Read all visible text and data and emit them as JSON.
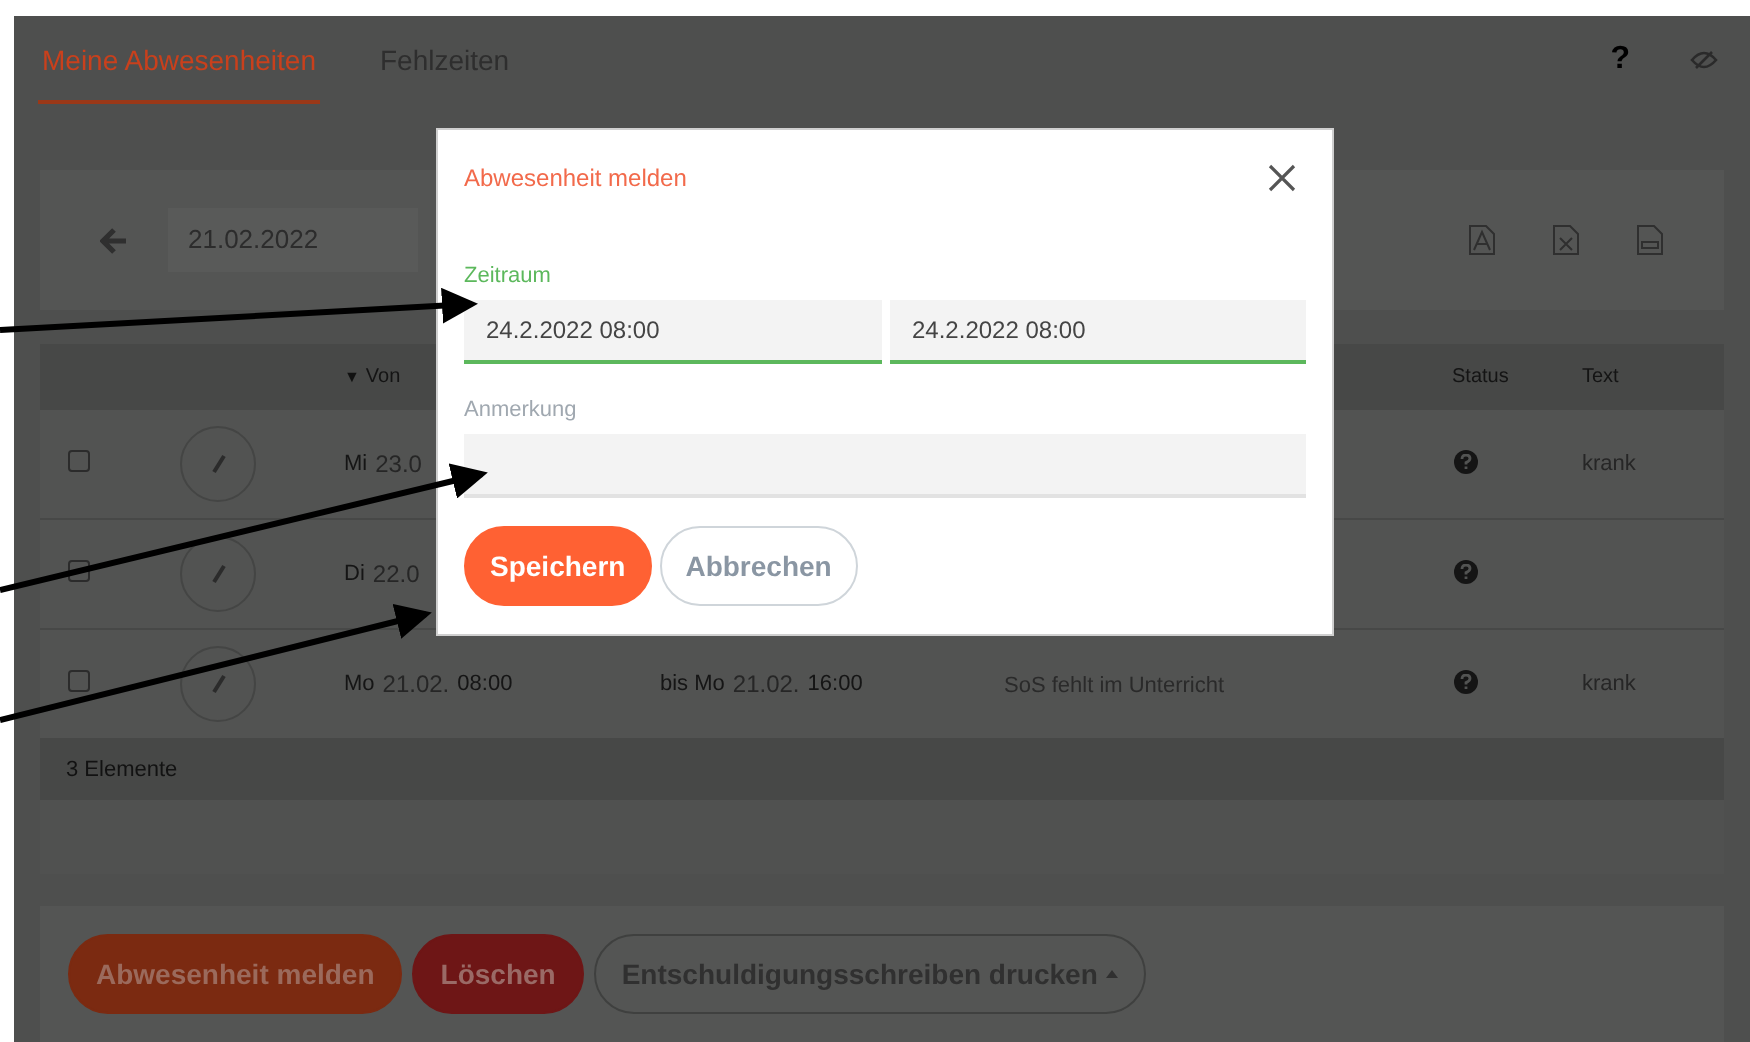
{
  "tabs": [
    {
      "label": "Meine Abwesenheiten",
      "selected": true
    },
    {
      "label": "Fehlzeiten",
      "selected": false
    }
  ],
  "help": "?",
  "toolbar": {
    "date": "21.02.2022"
  },
  "table": {
    "columns": [
      {
        "label": "Von",
        "sorted": true,
        "sort_indicator": "▼"
      },
      {
        "label": "Status",
        "sorted": false
      },
      {
        "label": "Text",
        "sorted": false
      }
    ],
    "rows": [
      {
        "checked": false,
        "from_day": "Mi",
        "from_date": "23.0",
        "text": "krank"
      },
      {
        "checked": false,
        "from_day": "Di",
        "from_date": "22.0"
      },
      {
        "checked": false,
        "from_day": "Mo",
        "from_date": "21.02.",
        "from_time": "08:00",
        "to_prefix": "bis Mo",
        "to_date": "21.02.",
        "to_time": "16:00",
        "reason": "SoS fehlt im Unterricht",
        "text": "krank"
      }
    ],
    "footer": "3 Elemente"
  },
  "actions": [
    {
      "label": "Abwesenheit melden",
      "kind": "primary"
    },
    {
      "label": "Löschen",
      "kind": "danger"
    },
    {
      "label": "Entschuldigungsschreiben drucken",
      "kind": "dropdown"
    }
  ],
  "dialog": {
    "title": "Abwesenheit melden",
    "period_label": "Zeitraum",
    "period_from": "24.2.2022 08:00",
    "period_to": "24.2.2022 08:00",
    "note_label": "Anmerkung",
    "buttons": [
      {
        "label": "Speichern",
        "kind": "primary"
      },
      {
        "label": "Abbrechen",
        "kind": "secondary"
      }
    ]
  }
}
